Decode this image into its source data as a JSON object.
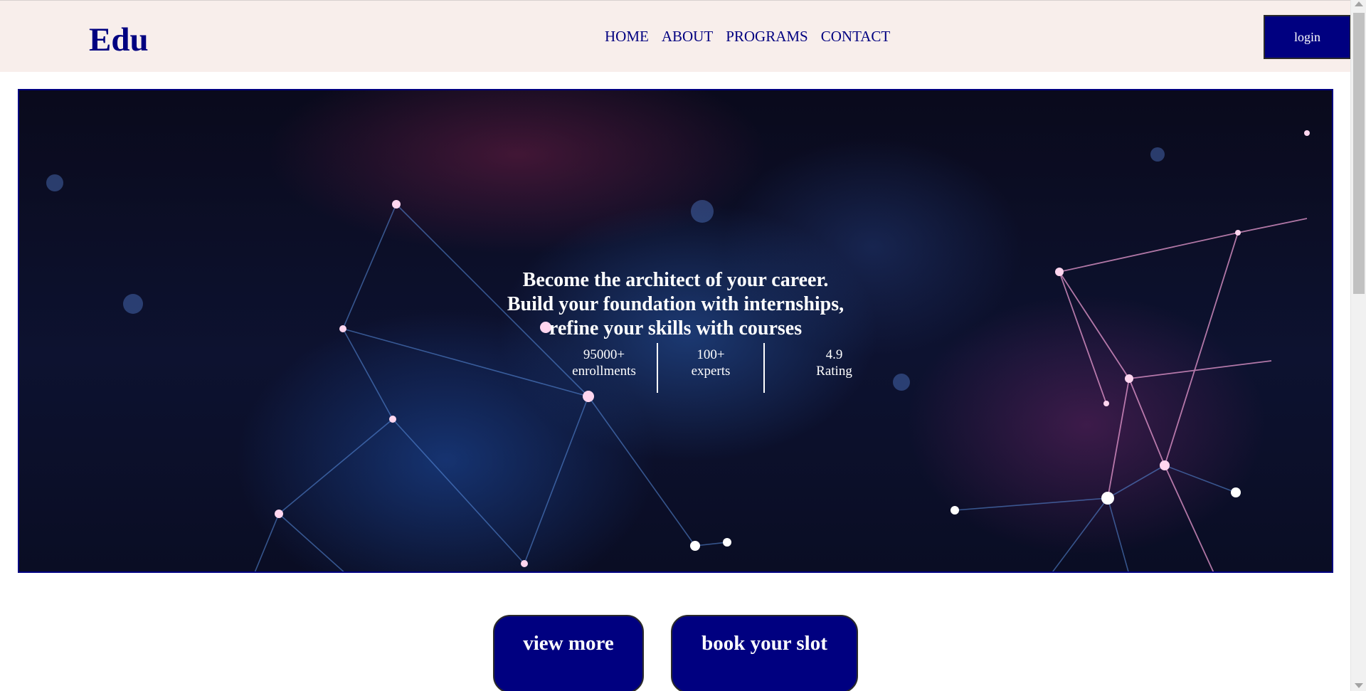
{
  "header": {
    "logo": "Edu",
    "nav": [
      "HOME",
      "ABOUT",
      "PROGRAMS",
      "CONTACT"
    ],
    "login_label": "login"
  },
  "hero": {
    "lines": [
      "Become the architect of your career.",
      "Build your foundation with internships,",
      "refine your skills with courses"
    ],
    "stats": [
      {
        "value": "95000+",
        "label": "enrollments"
      },
      {
        "value": "100+",
        "label": "experts"
      },
      {
        "value": "4.9",
        "label": "Rating"
      }
    ]
  },
  "cta": {
    "view_more": "view more",
    "book_slot": "book your slot"
  },
  "colors": {
    "brand": "#000080",
    "nav_bg": "#f8eeeb"
  }
}
